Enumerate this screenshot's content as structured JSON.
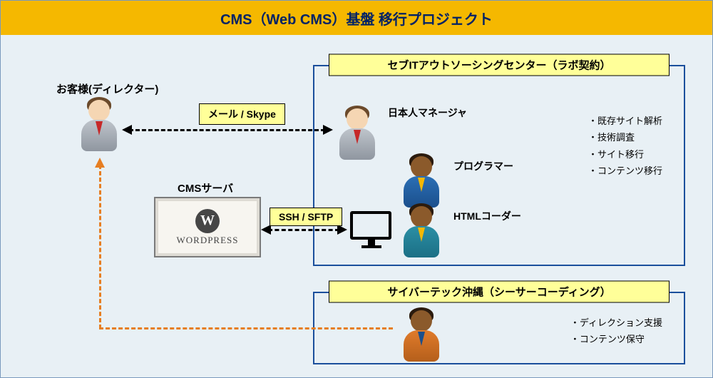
{
  "title": "CMS（Web CMS）基盤 移行プロジェクト",
  "customer": {
    "label": "お客様(ディレクター)"
  },
  "server": {
    "label": "CMSサーバ",
    "logo_text": "WORDPRESS",
    "logo_letter": "W"
  },
  "comm_mail": "メール / Skype",
  "comm_ssh": "SSH / SFTP",
  "cebu_panel": {
    "title": "セブITアウトソーシングセンター（ラボ契約）",
    "roles": {
      "manager": "日本人マネージャ",
      "programmer": "プログラマー",
      "coder": "HTMLコーダー"
    },
    "tasks": [
      "既存サイト解析",
      "技術調査",
      "サイト移行",
      "コンテンツ移行"
    ]
  },
  "okinawa_panel": {
    "title": "サイバーテック沖縄（シーサーコーディング）",
    "tasks": [
      "ディレクション支援",
      "コンテンツ保守"
    ]
  }
}
